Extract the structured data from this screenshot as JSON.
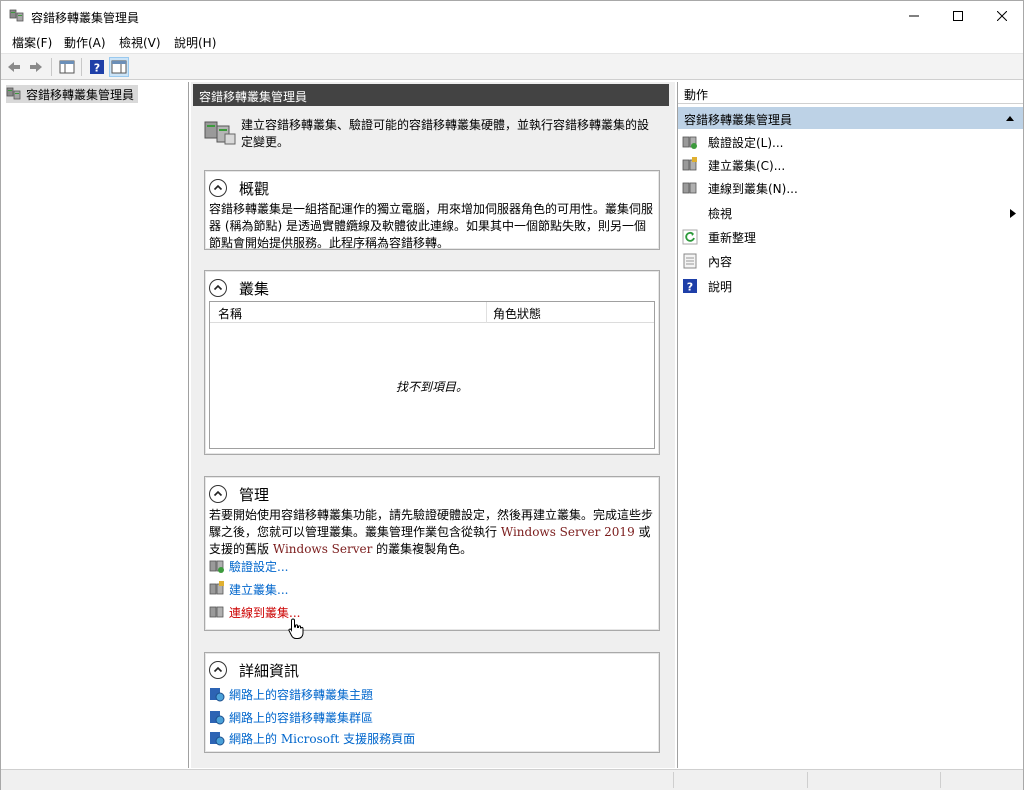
{
  "window": {
    "title": "容錯移轉叢集管理員",
    "controls": [
      "minimize",
      "maximize",
      "close"
    ]
  },
  "menu": [
    "檔案(F)",
    "動作(A)",
    "檢視(V)",
    "說明(H)"
  ],
  "tree": {
    "root_label": "容錯移轉叢集管理員"
  },
  "center": {
    "header": "容錯移轉叢集管理員",
    "intro": "建立容錯移轉叢集、驗證可能的容錯移轉叢集硬體，並執行容錯移轉叢集的設定變更。",
    "overview": {
      "title": "概觀",
      "text": "容錯移轉叢集是一組搭配運作的獨立電腦，用來增加伺服器角色的可用性。叢集伺服器 (稱為節點) 是透過實體纜線及軟體彼此連線。如果其中一個節點失敗，則另一個節點會開始提供服務。此程序稱為容錯移轉。"
    },
    "clusters": {
      "title": "叢集",
      "columns": [
        "名稱",
        "角色狀態"
      ],
      "empty_message": "找不到項目。"
    },
    "management": {
      "title": "管理",
      "text_part1": "若要開始使用容錯移轉叢集功能，請先驗證硬體設定，然後再建立叢集。完成這些步驟之後，您就可以管理叢集。叢集管理作業包含從執行 ",
      "text_product1": "Windows Server 2019",
      "text_part2": " 或支援的舊版 ",
      "text_product2": "Windows Server",
      "text_part3": " 的叢集複製角色。",
      "links": [
        "驗證設定...",
        "建立叢集...",
        "連線到叢集..."
      ]
    },
    "more_info": {
      "title": "詳細資訊",
      "links": [
        "網路上的容錯移轉叢集主題",
        "網路上的容錯移轉叢集群區",
        "網路上的 Microsoft 支援服務頁面"
      ]
    }
  },
  "actions": {
    "title": "動作",
    "group": "容錯移轉叢集管理員",
    "items": [
      "驗證設定(L)...",
      "建立叢集(C)...",
      "連線到叢集(N)...",
      "檢視",
      "重新整理",
      "內容",
      "說明"
    ]
  },
  "colors": {
    "center_header_bg": "#434343",
    "actions_group_bg": "#bdd2e6",
    "link": "#0066cc",
    "link_hover": "#cc0000",
    "help_icon": "#1e3fa8"
  }
}
